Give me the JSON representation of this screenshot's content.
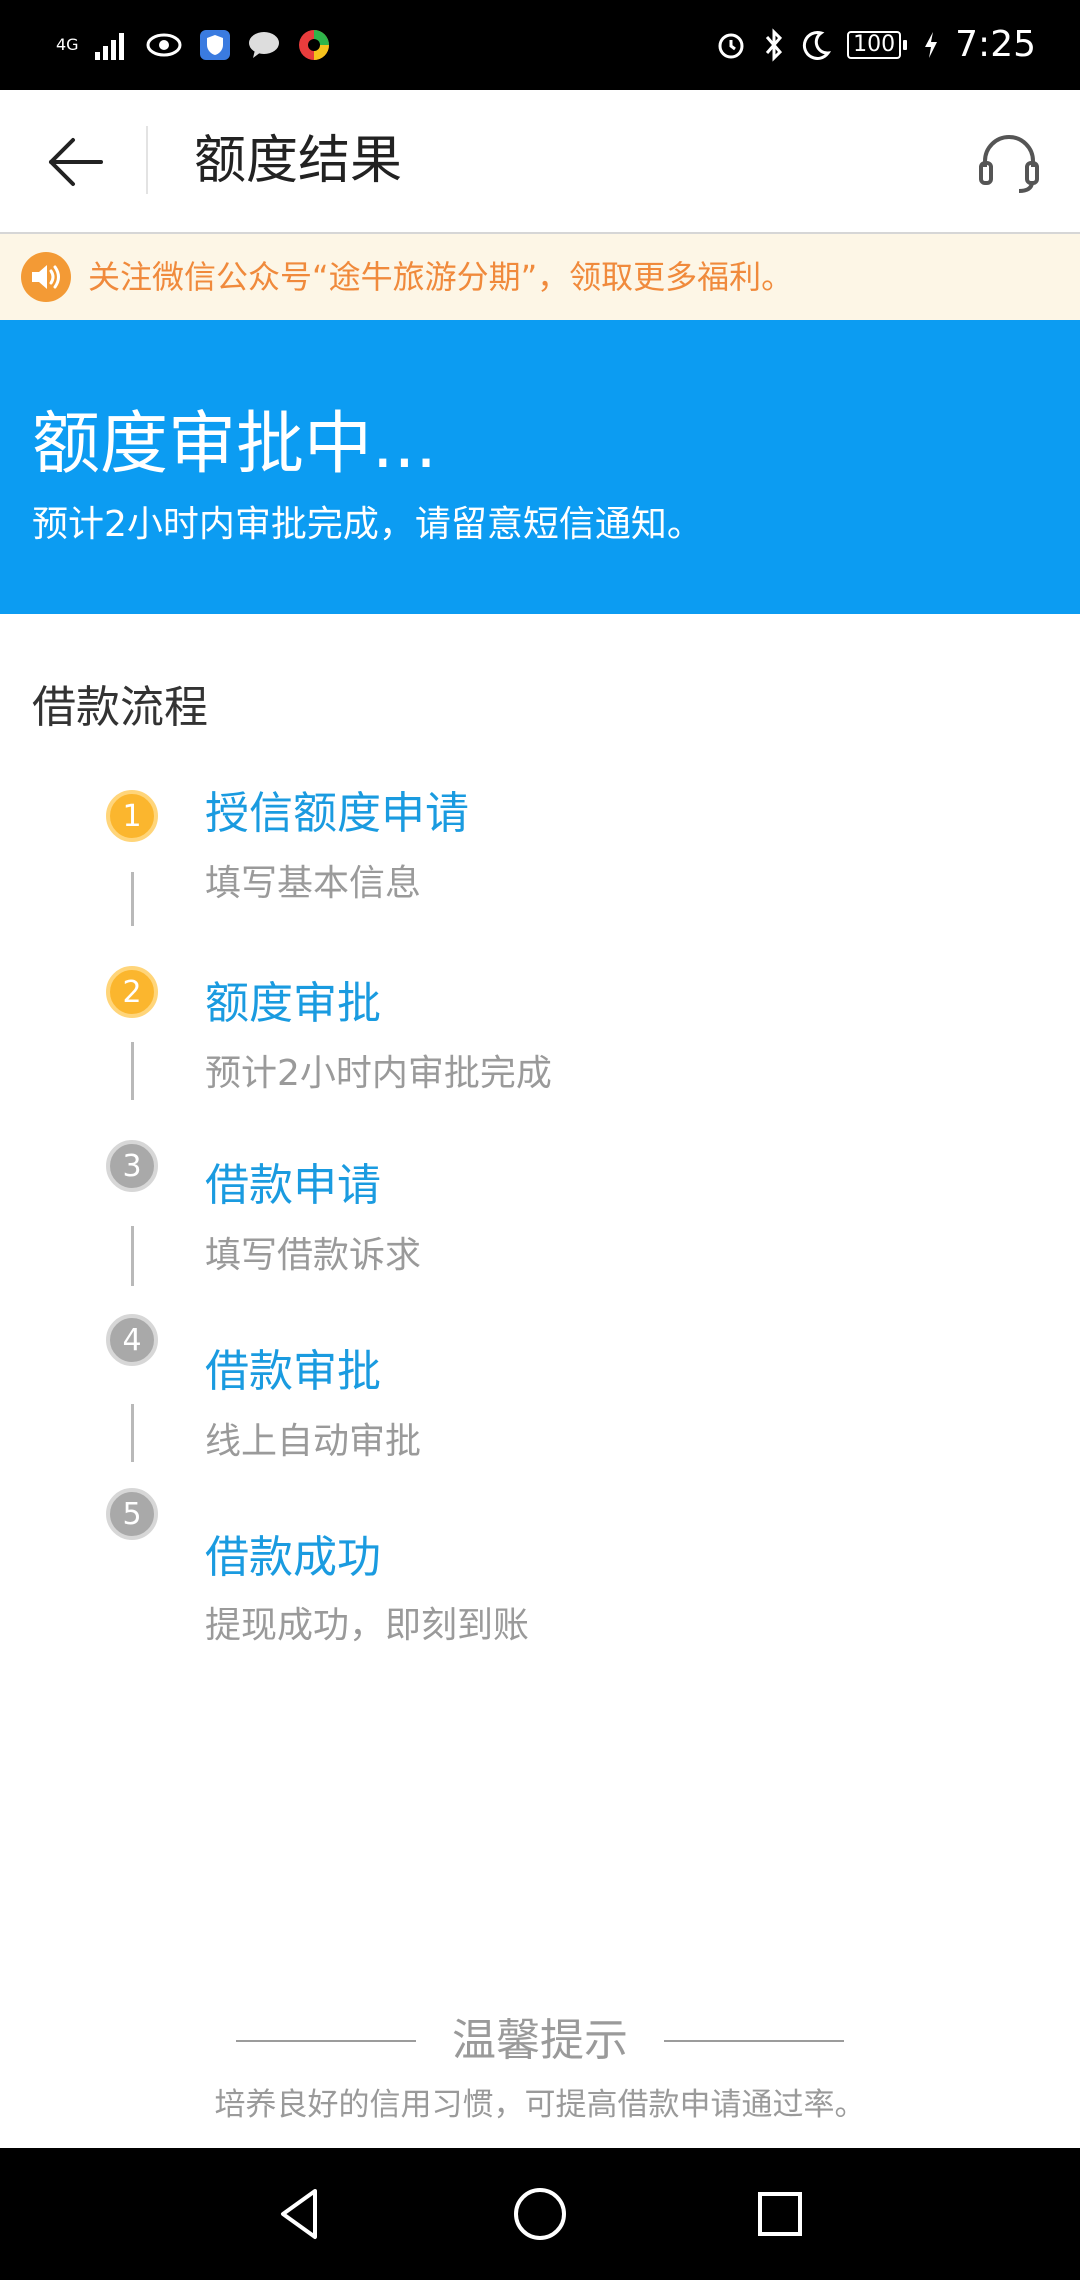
{
  "status_bar": {
    "network": "4G",
    "battery": "100",
    "time": "7:25"
  },
  "header": {
    "title": "额度结果"
  },
  "notice": {
    "text": "关注微信公众号“途牛旅游分期”，领取更多福利。",
    "color": "#f08a3c"
  },
  "hero": {
    "title": "额度审批中...",
    "subtitle": "预计2小时内审批完成，请留意短信通知。",
    "background": "#0c9cf2"
  },
  "process": {
    "title": "借款流程",
    "steps": [
      {
        "number": "1",
        "title": "授信额度申请",
        "desc": "填写基本信息",
        "state": "active"
      },
      {
        "number": "2",
        "title": "额度审批",
        "desc": "预计2小时内审批完成",
        "state": "active"
      },
      {
        "number": "3",
        "title": "借款申请",
        "desc": "填写借款诉求",
        "state": "pending"
      },
      {
        "number": "4",
        "title": "借款审批",
        "desc": "线上自动审批",
        "state": "pending"
      },
      {
        "number": "5",
        "title": "借款成功",
        "desc": "提现成功，即刻到账",
        "state": "pending"
      }
    ]
  },
  "tips": {
    "title": "温馨提示",
    "text": "培养良好的信用习惯，可提高借款申请通过率。"
  },
  "icons": {
    "back": "arrow-left-icon",
    "service": "headset-icon",
    "notice": "speaker-icon",
    "nav_back": "triangle-back-icon",
    "nav_home": "circle-home-icon",
    "nav_recent": "square-recent-icon"
  }
}
